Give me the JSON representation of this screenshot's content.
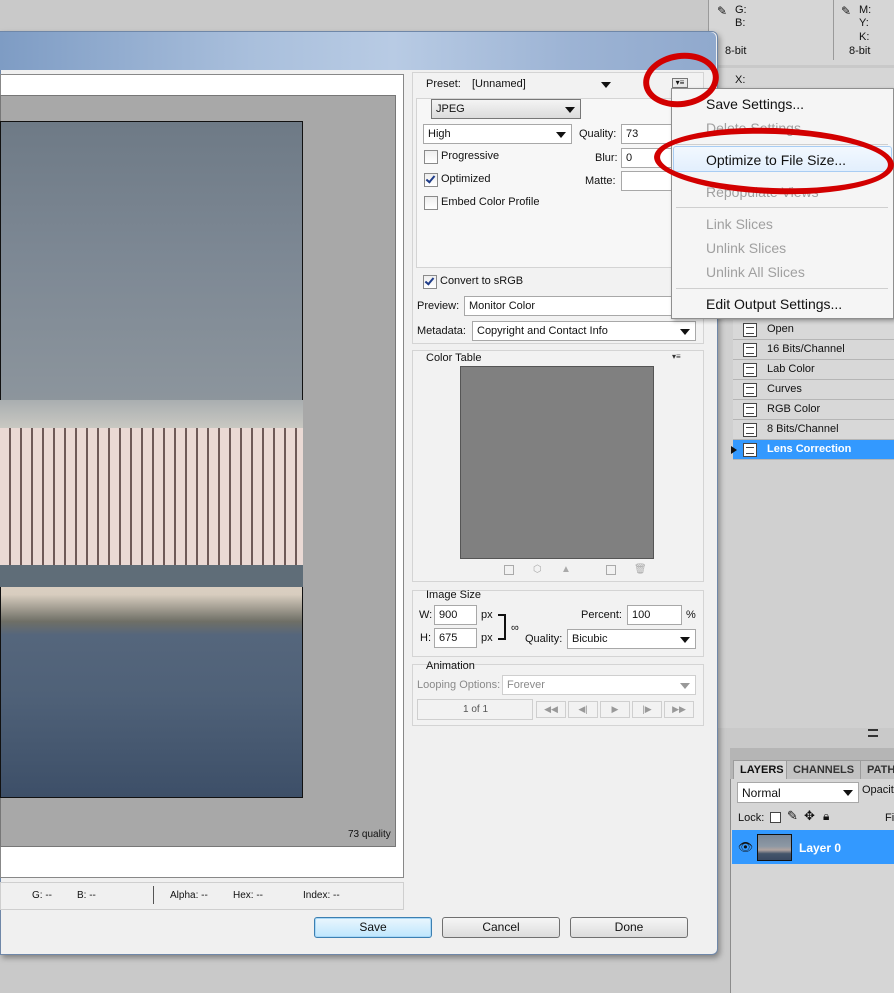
{
  "info_panel": {
    "g": "G:",
    "b": "B:",
    "m": "M:",
    "y": "Y:",
    "k": "K:",
    "bit_left": "8-bit",
    "bit_right": "8-bit",
    "x": "X:"
  },
  "settings": {
    "preset_label": "Preset:",
    "preset_value": "[Unnamed]",
    "format": "JPEG",
    "quality_preset": "High",
    "quality_label": "Quality:",
    "quality_value": "73",
    "progressive_label": "Progressive",
    "optimized_label": "Optimized",
    "embed_profile_label": "Embed Color Profile",
    "blur_label": "Blur:",
    "blur_value": "0",
    "matte_label": "Matte:",
    "convert_label": "Convert to sRGB",
    "preview_label": "Preview:",
    "preview_value": "Monitor Color",
    "metadata_label": "Metadata:",
    "metadata_value": "Copyright and Contact Info"
  },
  "color_table": {
    "title": "Color Table"
  },
  "image_size": {
    "title": "Image Size",
    "w_label": "W:",
    "w_value": "900",
    "h_label": "H:",
    "h_value": "675",
    "px1": "px",
    "px2": "px",
    "percent_label": "Percent:",
    "percent_value": "100",
    "percent_sign": "%",
    "quality_label": "Quality:",
    "quality_value": "Bicubic"
  },
  "animation": {
    "title": "Animation",
    "looping_label": "Looping Options:",
    "looping_value": "Forever",
    "frame_counter": "1 of 1"
  },
  "preview_pane": {
    "quality_caption": "73 quality"
  },
  "status_bar": {
    "g": "G: --",
    "b": "B: --",
    "alpha": "Alpha: --",
    "hex": "Hex: --",
    "index": "Index: --"
  },
  "buttons": {
    "save": "Save",
    "cancel": "Cancel",
    "done": "Done"
  },
  "flyout_menu": {
    "save_settings": "Save Settings...",
    "delete_settings": "Delete Settings",
    "optimize": "Optimize to File Size...",
    "repopulate": "Repopulate Views",
    "link": "Link Slices",
    "unlink": "Unlink Slices",
    "unlink_all": "Unlink All Slices",
    "edit_output": "Edit Output Settings..."
  },
  "history": {
    "items": [
      "Open",
      "16 Bits/Channel",
      "Lab Color",
      "Curves",
      "RGB Color",
      "8 Bits/Channel",
      "Lens Correction"
    ]
  },
  "layers_panel": {
    "tabs": [
      "LAYERS",
      "CHANNELS",
      "PATH"
    ],
    "blend_mode": "Normal",
    "opacity_label": "Opacit",
    "lock_label": "Lock:",
    "fill_label": "Fi",
    "layer_name": "Layer 0"
  },
  "colors": {
    "accent": "#3399ff",
    "annotation": "#d20000"
  }
}
